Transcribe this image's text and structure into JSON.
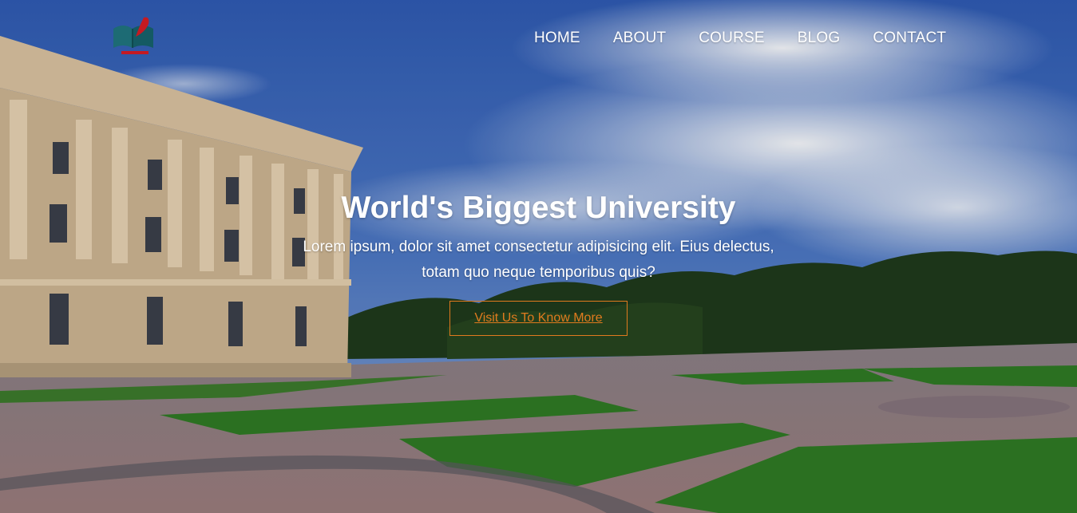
{
  "nav": {
    "logo_icon": "book-feather-logo-icon",
    "links": [
      "HOME",
      "ABOUT",
      "COURSE",
      "BLOG",
      "CONTACT"
    ]
  },
  "hero": {
    "title": "World's Biggest University",
    "subtitle": "Lorem ipsum, dolor sit amet consectetur adipisicing elit. Eius delectus, totam quo neque temporibus quis?",
    "cta_label": "Visit Us To Know More",
    "background_image": "university-campus-photo"
  },
  "colors": {
    "accent": "#e07a1e",
    "text": "#ffffff",
    "sky": "#3a66b8",
    "lawn": "#2f7a24"
  }
}
